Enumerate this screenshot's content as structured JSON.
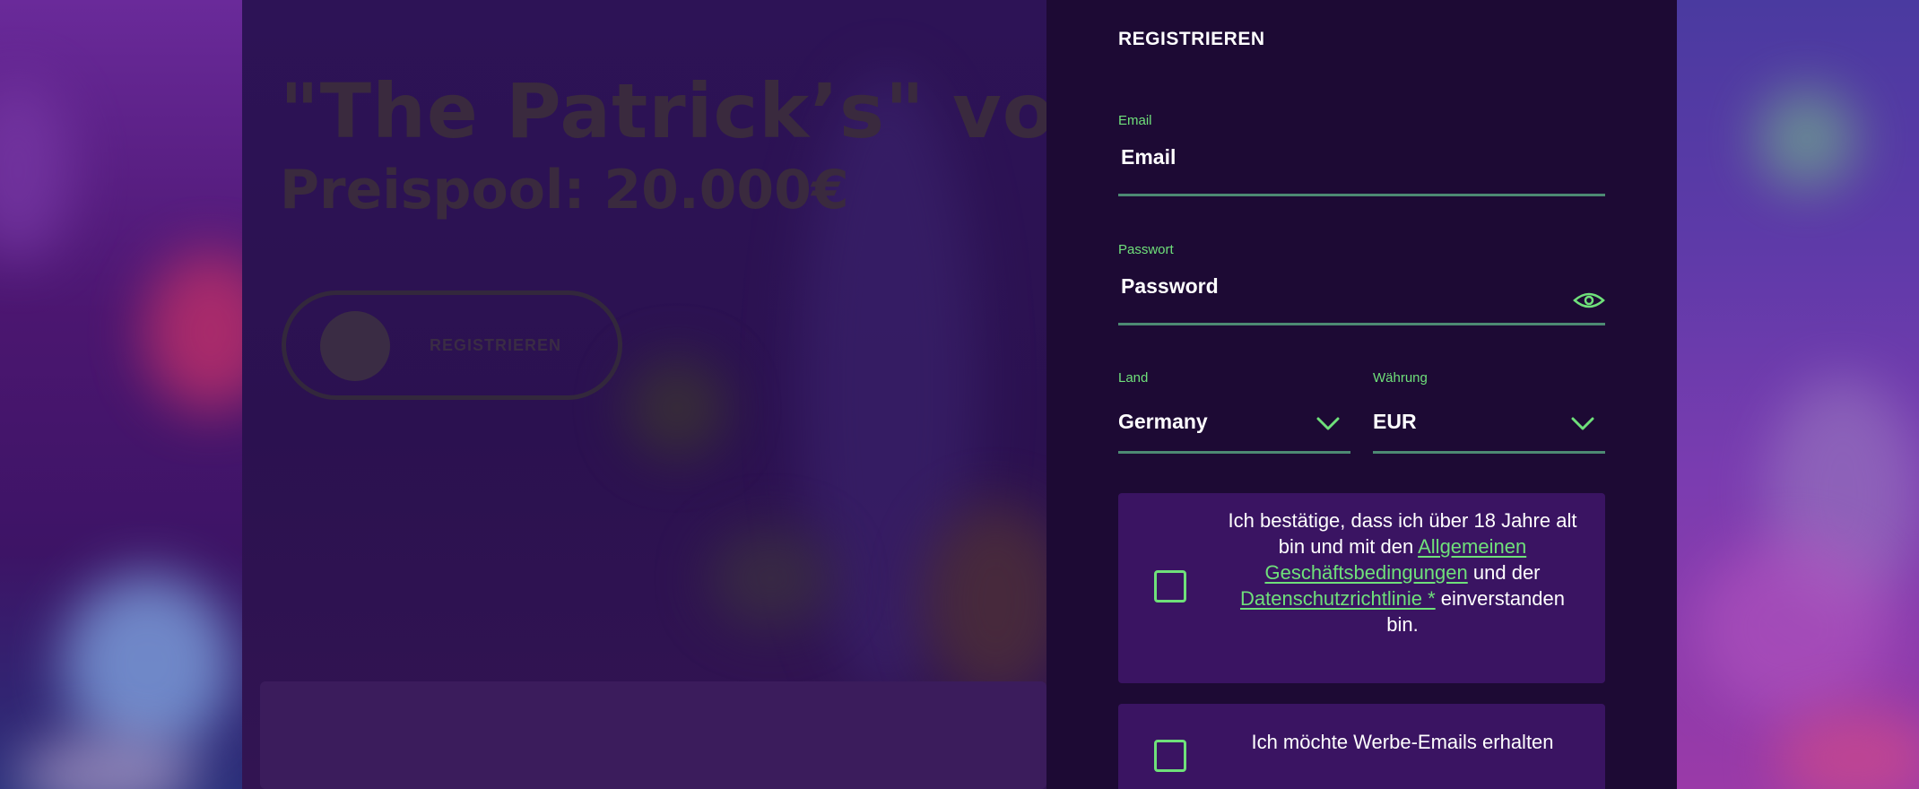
{
  "promo": {
    "title": "\"The Patrick’s\" von",
    "pool": "Preispool: 20.000€",
    "button_label": "REGISTRIEREN"
  },
  "register": {
    "title": "REGISTRIEREN",
    "email": {
      "label": "Email",
      "placeholder": "Email"
    },
    "password": {
      "label": "Passwort",
      "placeholder": "Password",
      "toggle_icon": "eye-icon"
    },
    "country": {
      "label": "Land",
      "value": "Germany"
    },
    "currency": {
      "label": "Währung",
      "value": "EUR"
    },
    "terms": {
      "text_before": "Ich bestätige, dass ich über 18 Jahre alt bin und mit den",
      "link_terms": "Allgemeinen Geschäftsbedingungen",
      "text_middle": "und der",
      "link_privacy": "Datenschutzrichtlinie *",
      "text_after": "einverstanden bin."
    },
    "marketing": {
      "text": "Ich möchte Werbe-Emails erhalten"
    }
  },
  "colors": {
    "accent": "#6fe07a",
    "panel_bg": "#1d0a34",
    "consent_bg": "#3a1462",
    "underline": "#4d8a73"
  }
}
